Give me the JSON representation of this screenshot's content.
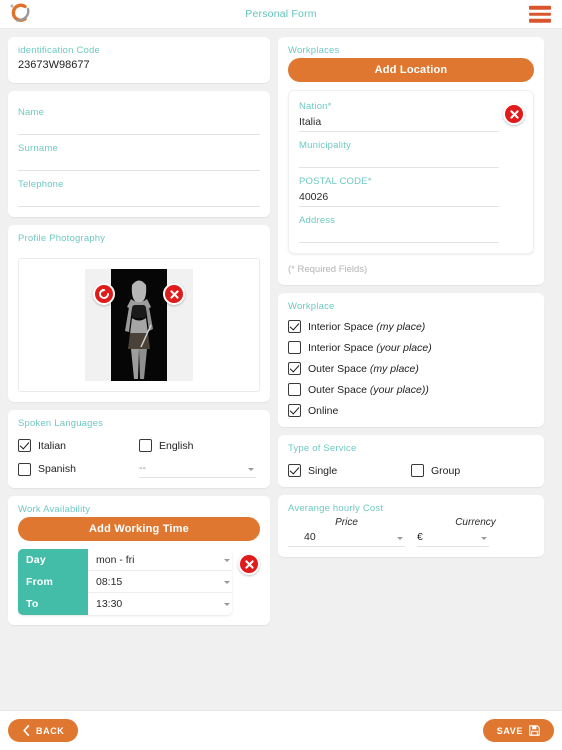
{
  "header": {
    "title": "Personal Form",
    "logo_icon": "company-logo",
    "menu_icon": "hamburger-menu-icon"
  },
  "left": {
    "identification": {
      "label": "identification Code",
      "value": "23673W98677"
    },
    "personal": {
      "name_label": "Name",
      "name_value": "",
      "surname_label": "Surname",
      "surname_value": "",
      "telephone_label": "Telephone",
      "telephone_value": ""
    },
    "photo": {
      "label": "Profile Photography",
      "rotate_icon": "rotate-icon",
      "delete_icon": "close-icon"
    },
    "languages": {
      "label": "Spoken Languages",
      "items": [
        {
          "label": "Italian",
          "checked": true
        },
        {
          "label": "English",
          "checked": false
        },
        {
          "label": "Spanish",
          "checked": false
        }
      ],
      "extra_select": "--"
    },
    "availability": {
      "label": "Work Availability",
      "add_button": "Add Working Time",
      "rows": [
        {
          "label": "Day",
          "value": "mon - fri"
        },
        {
          "label": "From",
          "value": "08:15"
        },
        {
          "label": "To",
          "value": "13:30"
        }
      ],
      "delete_icon": "close-icon"
    }
  },
  "right": {
    "workplaces": {
      "label": "Workplaces",
      "add_button": "Add Location",
      "location": {
        "nation_label": "Nation",
        "nation_required": "*",
        "nation_value": "Italia",
        "municipality_label": "Municipality",
        "municipality_value": "",
        "postal_label": "POSTAL CODE",
        "postal_required": "*",
        "postal_value": "40026",
        "address_label": "Address",
        "address_value": "",
        "delete_icon": "close-icon"
      },
      "required_note": "(* Required Fields)"
    },
    "workplace": {
      "label": "Workplace",
      "items": [
        {
          "text": "Interior Space ",
          "em": "(my place)",
          "checked": true
        },
        {
          "text": "Interior Space ",
          "em": "(your place)",
          "checked": false
        },
        {
          "text": "Outer Space ",
          "em": "(my place)",
          "checked": true
        },
        {
          "text": "Outer Space ",
          "em": "(your place))",
          "checked": false
        },
        {
          "text": "Online",
          "em": "",
          "checked": true
        }
      ]
    },
    "service": {
      "label": "Type of Service",
      "items": [
        {
          "label": "Single",
          "checked": true
        },
        {
          "label": "Group",
          "checked": false
        }
      ]
    },
    "cost": {
      "label": "Averange hourly Cost",
      "price_header": "Price",
      "price_value": "40",
      "currency_header": "Currency",
      "currency_value": "€"
    }
  },
  "footer": {
    "back_label": "BACK",
    "back_icon": "chevron-left-icon",
    "save_label": "SAVE",
    "save_icon": "floppy-disk-icon"
  },
  "colors": {
    "accent_orange": "#df7730",
    "teal": "#6fc9c2",
    "teal_solid": "#43bda8",
    "danger_red": "#e01b1b",
    "page_bg": "#f0f0f0"
  }
}
